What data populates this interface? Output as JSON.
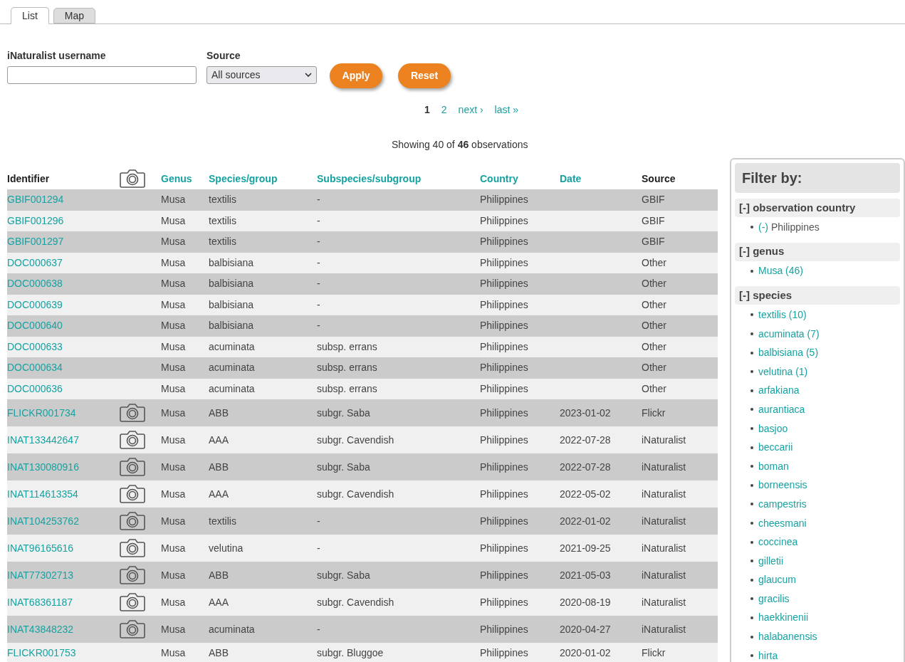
{
  "tabs": [
    {
      "label": "List",
      "selected": true
    },
    {
      "label": "Map",
      "selected": false
    }
  ],
  "form": {
    "username_label": "iNaturalist username",
    "source_label": "Source",
    "source_value": "All sources",
    "buttons": [
      "Apply",
      "Reset"
    ]
  },
  "pagination": [
    {
      "label": "1",
      "current": true
    },
    {
      "label": "2",
      "current": false
    },
    {
      "label": "next ›",
      "current": false
    },
    {
      "label": "last »",
      "current": false
    }
  ],
  "summary": "Showing 40 of **46** observations",
  "table": {
    "columns": [
      {
        "label": "Identifier",
        "kind": "text"
      },
      {
        "kind": "photo"
      },
      {
        "label": "Genus",
        "kind": "link"
      },
      {
        "label": "Species/group",
        "kind": "link"
      },
      {
        "label": "Subspecies/subgroup",
        "kind": "link"
      },
      {
        "label": "Country",
        "kind": "link"
      },
      {
        "label": "Date",
        "kind": "link"
      },
      {
        "label": "Source",
        "kind": "text"
      }
    ],
    "rows": [
      {
        "id": "GBIF001294",
        "photo": false,
        "genus": "Musa",
        "species": "textilis",
        "subspecies": "-",
        "country": "Philippines",
        "source": "GBIF"
      },
      {
        "id": "GBIF001296",
        "photo": false,
        "genus": "Musa",
        "species": "textilis",
        "subspecies": "-",
        "country": "Philippines",
        "source": "GBIF"
      },
      {
        "id": "GBIF001297",
        "photo": false,
        "genus": "Musa",
        "species": "textilis",
        "subspecies": "-",
        "country": "Philippines",
        "source": "GBIF"
      },
      {
        "id": "DOC000637",
        "photo": false,
        "genus": "Musa",
        "species": "balbisiana",
        "subspecies": "-",
        "country": "Philippines",
        "source": "Other"
      },
      {
        "id": "DOC000638",
        "photo": false,
        "genus": "Musa",
        "species": "balbisiana",
        "subspecies": "-",
        "country": "Philippines",
        "source": "Other"
      },
      {
        "id": "DOC000639",
        "photo": false,
        "genus": "Musa",
        "species": "balbisiana",
        "subspecies": "-",
        "country": "Philippines",
        "source": "Other"
      },
      {
        "id": "DOC000640",
        "photo": false,
        "genus": "Musa",
        "species": "balbisiana",
        "subspecies": "-",
        "country": "Philippines",
        "source": "Other"
      },
      {
        "id": "DOC000633",
        "photo": false,
        "genus": "Musa",
        "species": "acuminata",
        "subspecies": "subsp. errans",
        "country": "Philippines",
        "source": "Other"
      },
      {
        "id": "DOC000634",
        "photo": false,
        "genus": "Musa",
        "species": "acuminata",
        "subspecies": "subsp. errans",
        "country": "Philippines",
        "source": "Other"
      },
      {
        "id": "DOC000636",
        "photo": false,
        "genus": "Musa",
        "species": "acuminata",
        "subspecies": "subsp. errans",
        "country": "Philippines",
        "source": "Other"
      },
      {
        "id": "FLICKR001734",
        "photo": true,
        "genus": "Musa",
        "species": "ABB",
        "subspecies": "subgr. Saba",
        "country": "Philippines",
        "date": "2023-01-02",
        "source": "Flickr"
      },
      {
        "id": "INAT133442647",
        "photo": true,
        "genus": "Musa",
        "species": "AAA",
        "subspecies": "subgr. Cavendish",
        "country": "Philippines",
        "date": "2022-07-28",
        "source": "iNaturalist"
      },
      {
        "id": "INAT130080916",
        "photo": true,
        "genus": "Musa",
        "species": "ABB",
        "subspecies": "subgr. Saba",
        "country": "Philippines",
        "date": "2022-07-28",
        "source": "iNaturalist"
      },
      {
        "id": "INAT114613354",
        "photo": true,
        "genus": "Musa",
        "species": "AAA",
        "subspecies": "subgr. Cavendish",
        "country": "Philippines",
        "date": "2022-05-02",
        "source": "iNaturalist"
      },
      {
        "id": "INAT104253762",
        "photo": true,
        "genus": "Musa",
        "species": "textilis",
        "subspecies": "-",
        "country": "Philippines",
        "date": "2022-01-02",
        "source": "iNaturalist"
      },
      {
        "id": "INAT96165616",
        "photo": true,
        "genus": "Musa",
        "species": "velutina",
        "subspecies": "-",
        "country": "Philippines",
        "date": "2021-09-25",
        "source": "iNaturalist"
      },
      {
        "id": "INAT77302713",
        "photo": true,
        "genus": "Musa",
        "species": "ABB",
        "subspecies": "subgr. Saba",
        "country": "Philippines",
        "date": "2021-05-03",
        "source": "iNaturalist"
      },
      {
        "id": "INAT68361187",
        "photo": true,
        "genus": "Musa",
        "species": "AAA",
        "subspecies": "subgr. Cavendish",
        "country": "Philippines",
        "date": "2020-08-19",
        "source": "iNaturalist"
      },
      {
        "id": "INAT43848232",
        "photo": true,
        "genus": "Musa",
        "species": "acuminata",
        "subspecies": "-",
        "country": "Philippines",
        "date": "2020-04-27",
        "source": "iNaturalist"
      },
      {
        "id": "FLICKR001753",
        "photo": false,
        "genus": "Musa",
        "species": "ABB",
        "subspecies": "subgr. Bluggoe",
        "country": "Philippines",
        "date": "2020-01-02",
        "source": "Flickr"
      }
    ]
  },
  "filter": {
    "title": "Filter by:",
    "groups": [
      {
        "title": "[-] observation country",
        "items": [
          {
            "link": "(-)",
            "text": "Philippines"
          }
        ]
      },
      {
        "title": "[-] genus",
        "items": [
          {
            "link": "Musa (46)"
          }
        ]
      },
      {
        "title": "[-] species",
        "items": [
          {
            "link": "textilis (10)"
          },
          {
            "link": "acuminata (7)"
          },
          {
            "link": "balbisiana (5)"
          },
          {
            "link": "velutina (1)"
          },
          {
            "link": "arfakiana"
          },
          {
            "link": "aurantiaca"
          },
          {
            "link": "basjoo"
          },
          {
            "link": "beccarii"
          },
          {
            "link": "boman"
          },
          {
            "link": "borneensis"
          },
          {
            "link": "campestris"
          },
          {
            "link": "cheesmani"
          },
          {
            "link": "coccinea"
          },
          {
            "link": "gilletii"
          },
          {
            "link": "glaucum"
          },
          {
            "link": "gracilis"
          },
          {
            "link": "haekkinenii"
          },
          {
            "link": "halabanensis"
          },
          {
            "link": "hirta"
          }
        ]
      }
    ]
  }
}
